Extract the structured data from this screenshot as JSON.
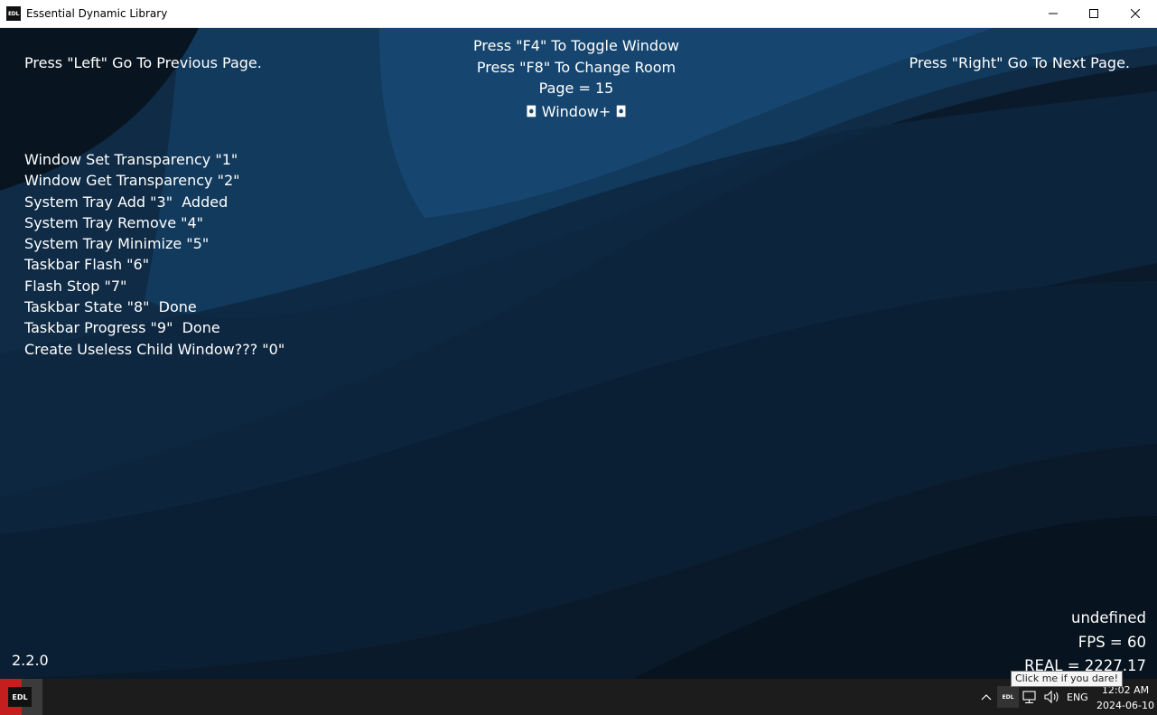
{
  "window": {
    "title": "Essential Dynamic Library",
    "logo_text": "EDL"
  },
  "viewport": {
    "nav_left": "Press \"Left\" Go To Previous Page.",
    "nav_right": "Press \"Right\" Go To Next Page.",
    "toggle_hint": "Press \"F4\" To Toggle Window",
    "room_hint": "Press \"F8\" To Change Room",
    "page_label": "Page = 15",
    "section_title": "◘ Window+ ◘",
    "menu_items": [
      "Window Set Transparency \"1\"",
      "Window Get Transparency \"2\"",
      "System Tray Add \"3\"  Added",
      "System Tray Remove \"4\"",
      "System Tray Minimize \"5\"",
      "Taskbar Flash \"6\"",
      "Flash Stop \"7\"",
      "Taskbar State \"8\"  Done",
      "Taskbar Progress \"9\"  Done",
      "Create Useless Child Window??? \"0\""
    ],
    "status_line": "undefined",
    "fps": "FPS = 60",
    "real": "REAL = 2227.17",
    "version": "2.2.0"
  },
  "taskbar": {
    "app_logo_text": "EDL",
    "tray_logo_text": "EDL",
    "language": "ENG",
    "time": "12:02 AM",
    "date": "2024-06-10",
    "tooltip": "Click me if you dare!"
  },
  "colors": {
    "background_dark": "#0a1520",
    "wave_blue": "#123a5c",
    "taskbar": "#1c1c1c",
    "app_accent": "#c41e1e"
  }
}
